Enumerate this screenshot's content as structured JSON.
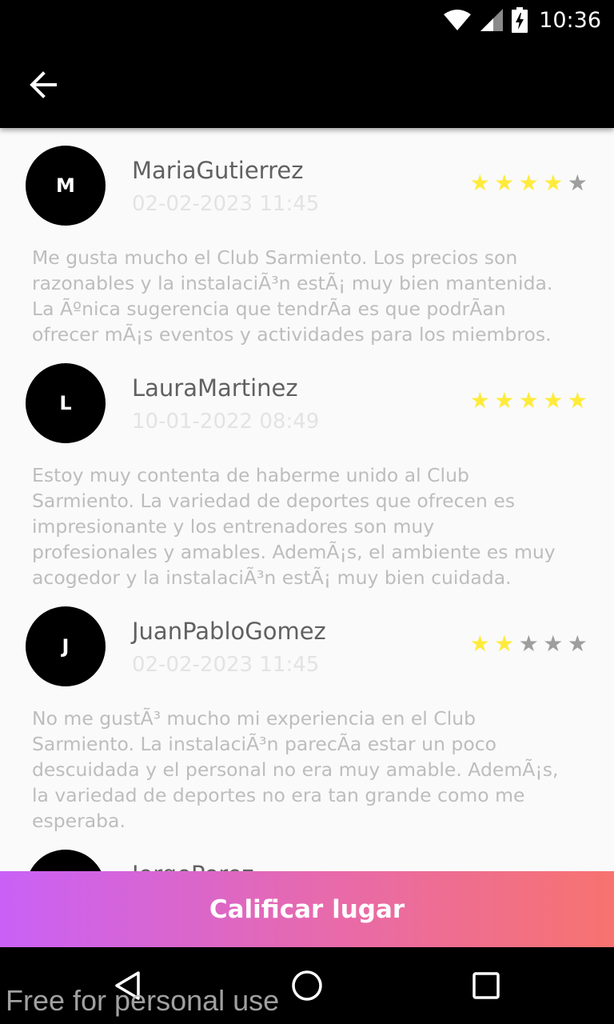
{
  "status_bar": {
    "time": "10:36",
    "icons": [
      "wifi-icon",
      "signal-icon",
      "battery-charging-icon"
    ]
  },
  "app_bar": {
    "back_icon": "arrow-back-icon"
  },
  "colors": {
    "star_filled": "#ffeb3b",
    "star_empty": "#9e9e9e",
    "gradient_start": "#c961f7",
    "gradient_end": "#f7736f"
  },
  "reviews": [
    {
      "initial": "M",
      "name": "MariaGutierrez",
      "date": "02-02-2023 11:45",
      "rating": 4,
      "text": "Me gusta mucho el Club Sarmiento. Los precios son\nrazonables y la instalaciÃ³n estÃ¡ muy bien mantenida.\nLa Ãºnica sugerencia que tendrÃa es que podrÃan\nofrecer mÃ¡s eventos y actividades para los miembros."
    },
    {
      "initial": "L",
      "name": "LauraMartinez",
      "date": "10-01-2022 08:49",
      "rating": 5,
      "text": "Estoy muy contenta de haberme unido al Club\nSarmiento. La variedad de deportes que ofrecen es\nimpresionante y los entrenadores son muy\nprofesionales y amables. AdemÃ¡s, el ambiente es muy\nacogedor y la instalaciÃ³n estÃ¡ muy bien cuidada."
    },
    {
      "initial": "J",
      "name": "JuanPabloGomez",
      "date": "02-02-2023 11:45",
      "rating": 2,
      "text": "No me gustÃ³ mucho mi experiencia en el Club\nSarmiento. La instalaciÃ³n parecÃa estar un poco\ndescuidada y el personal no era muy amable. AdemÃ¡s,\nla variedad de deportes no era tan grande como me\nesperaba."
    },
    {
      "initial": "",
      "name": "JorgePerez",
      "date": "",
      "rating": 0,
      "text": ""
    }
  ],
  "cta": {
    "label": "Calificar lugar"
  },
  "nav_bar": {
    "icons": [
      "nav-back-icon",
      "nav-home-icon",
      "nav-recents-icon"
    ]
  },
  "watermark": "Free for personal use"
}
